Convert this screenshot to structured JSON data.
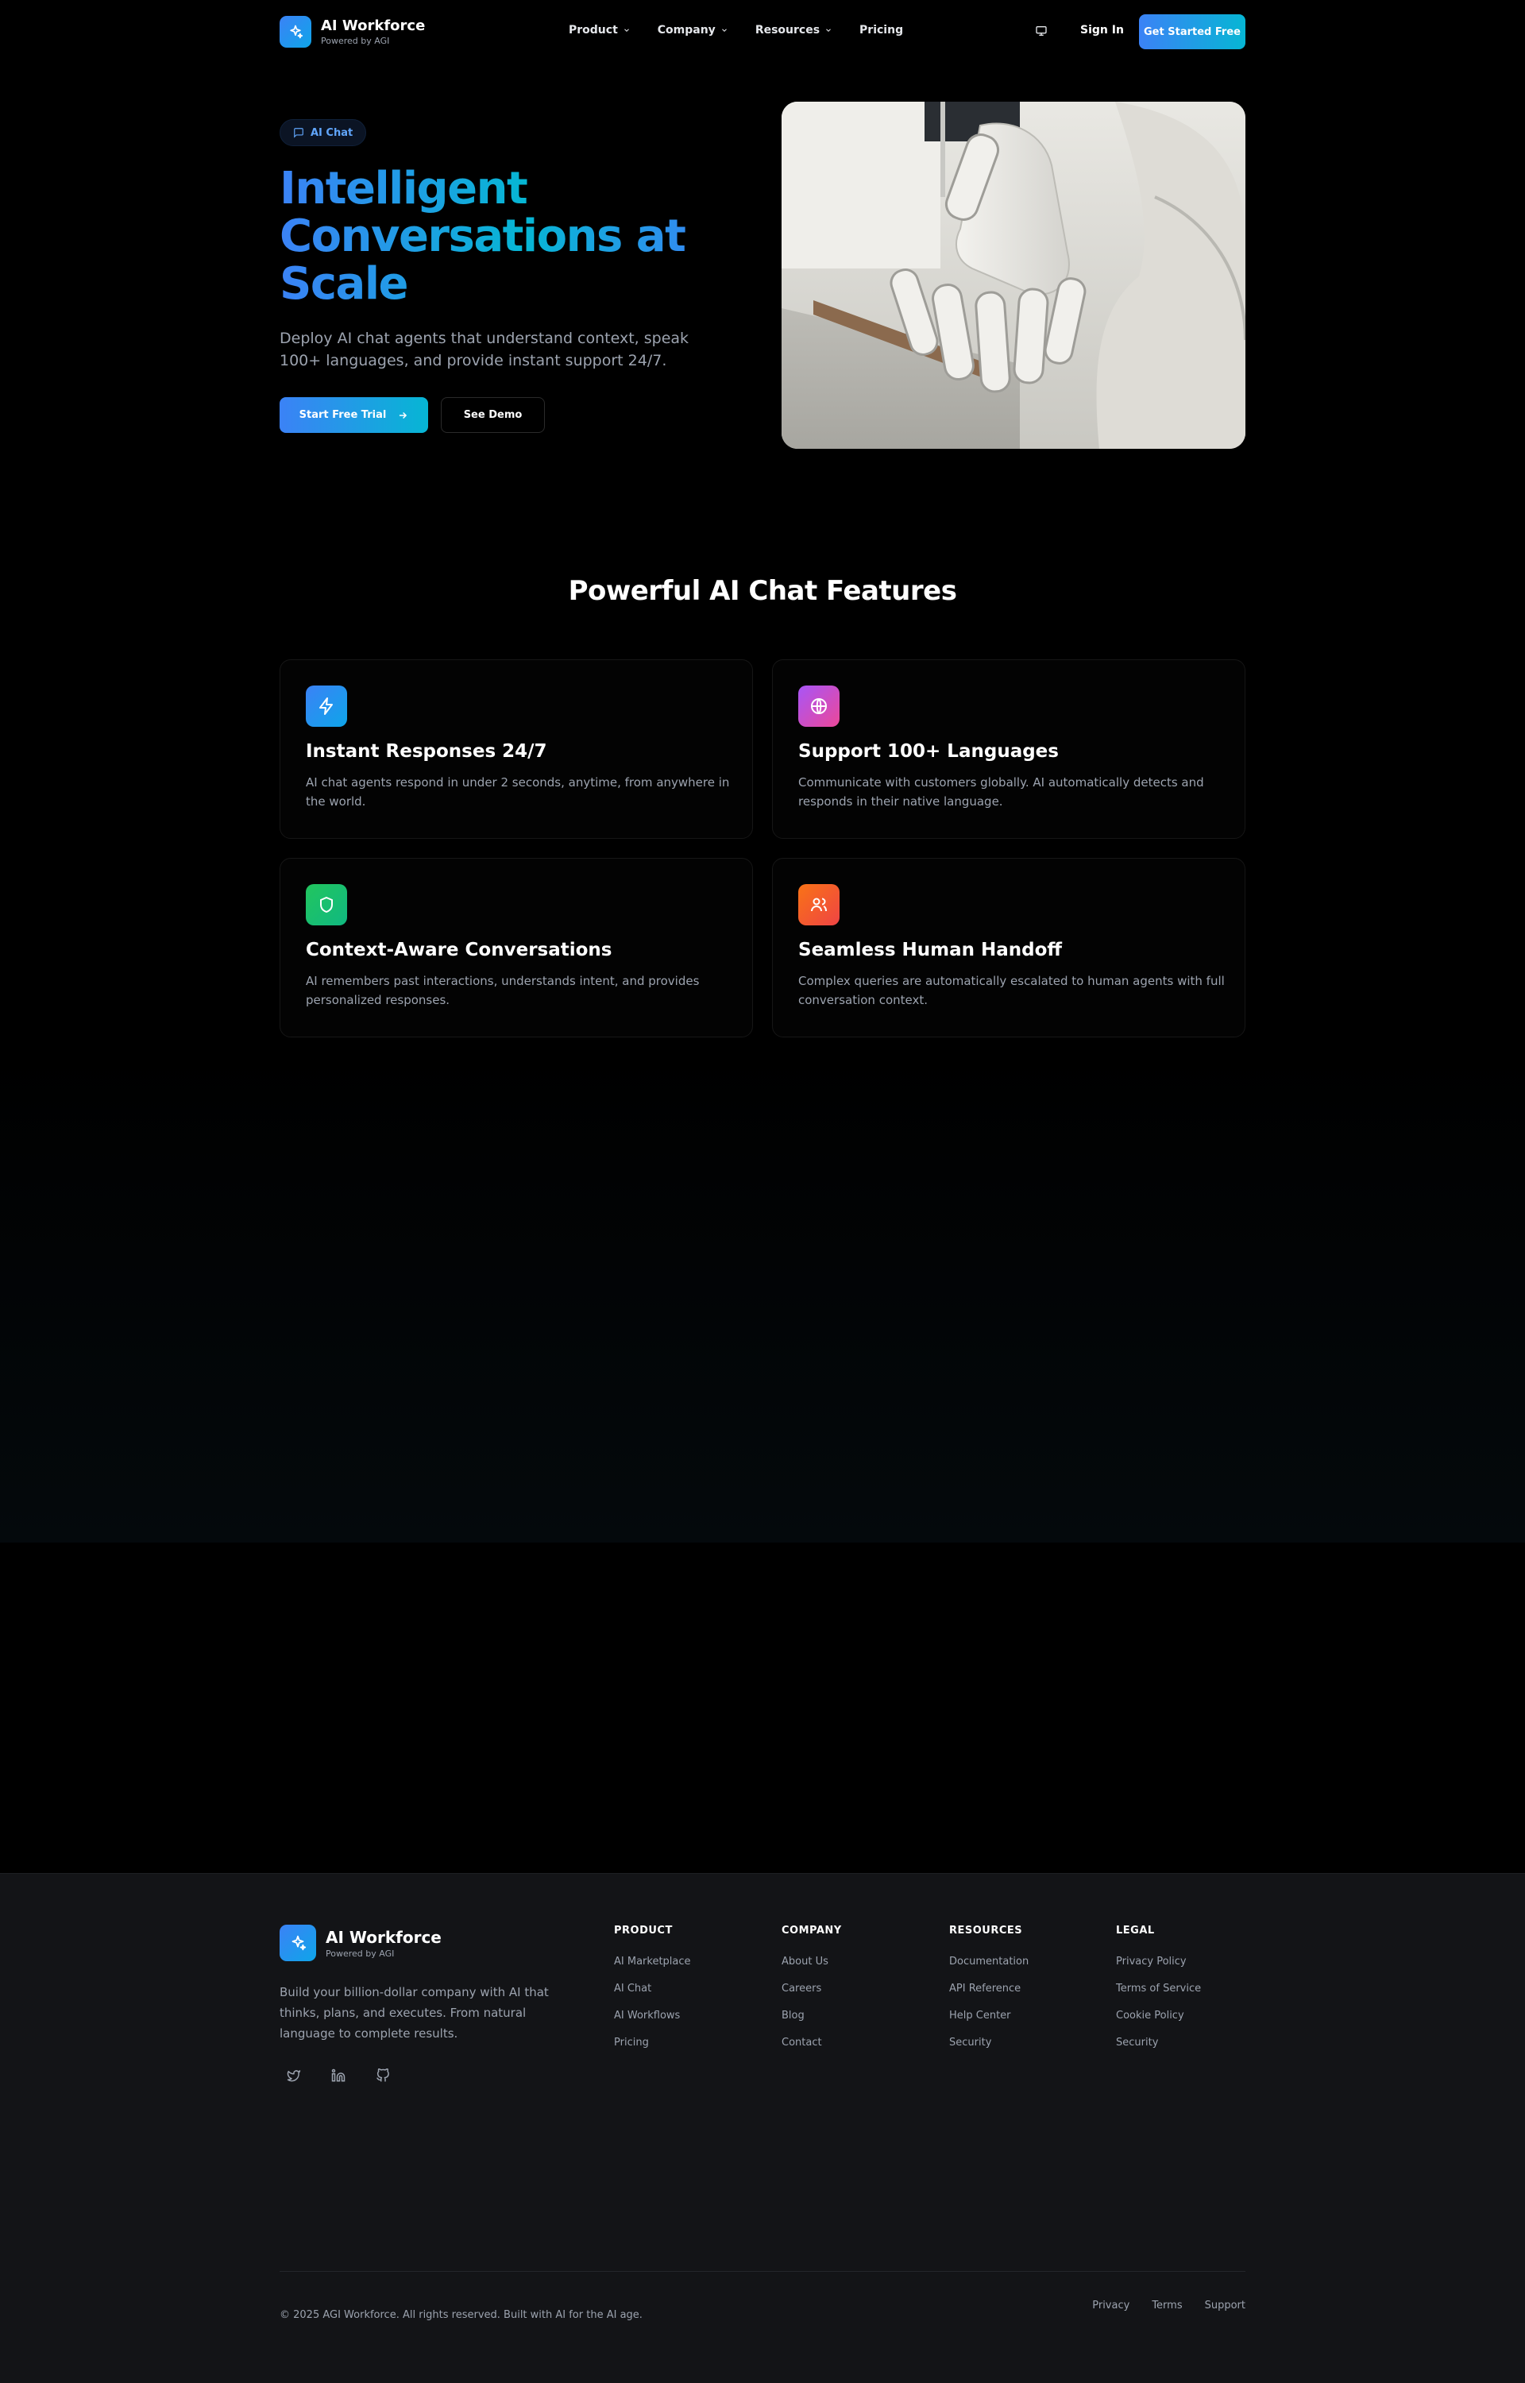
{
  "header": {
    "brand_name": "AI Workforce",
    "brand_sub": "Powered by AGI",
    "nav": [
      {
        "label": "Product",
        "has_dropdown": true
      },
      {
        "label": "Company",
        "has_dropdown": true
      },
      {
        "label": "Resources",
        "has_dropdown": true
      },
      {
        "label": "Pricing",
        "has_dropdown": false
      }
    ],
    "sign_in": "Sign In",
    "cta": "Get Started Free"
  },
  "hero": {
    "badge": "AI Chat",
    "title": "Intelligent Conversations at Scale",
    "description": "Deploy AI chat agents that understand context, speak 100+ languages, and provide instant support 24/7.",
    "primary_button": "Start Free Trial",
    "secondary_button": "See Demo"
  },
  "features": {
    "title": "Powerful AI Chat Features",
    "items": [
      {
        "icon": "zap-icon",
        "color": "#2f8cf0",
        "title": "Instant Responses 24/7",
        "description": "AI chat agents respond in under 2 seconds, anytime, from anywhere in the world."
      },
      {
        "icon": "globe-icon",
        "color": "#c13fd6",
        "title": "Support 100+ Languages",
        "description": "Communicate with customers globally. AI automatically detects and responds in their native language."
      },
      {
        "icon": "shield-icon",
        "color": "#16b86a",
        "title": "Context-Aware Conversations",
        "description": "AI remembers past interactions, understands intent, and provides personalized responses."
      },
      {
        "icon": "users-icon",
        "color": "#f2562c",
        "title": "Seamless Human Handoff",
        "description": "Complex queries are automatically escalated to human agents with full conversation context."
      }
    ]
  },
  "footer": {
    "brand_name": "AI Workforce",
    "brand_sub": "Powered by AGI",
    "description": "Build your billion-dollar company with AI that thinks, plans, and executes. From natural language to complete results.",
    "columns": [
      {
        "heading": "PRODUCT",
        "links": [
          "AI Marketplace",
          "AI Chat",
          "AI Workflows",
          "Pricing"
        ]
      },
      {
        "heading": "COMPANY",
        "links": [
          "About Us",
          "Careers",
          "Blog",
          "Contact"
        ]
      },
      {
        "heading": "RESOURCES",
        "links": [
          "Documentation",
          "API Reference",
          "Help Center",
          "Security"
        ]
      },
      {
        "heading": "LEGAL",
        "links": [
          "Privacy Policy",
          "Terms of Service",
          "Cookie Policy",
          "Security"
        ]
      }
    ],
    "copyright": "© 2025 AGI Workforce. All rights reserved. Built with AI for the AI age.",
    "bottom_links": [
      "Privacy",
      "Terms",
      "Support"
    ]
  }
}
